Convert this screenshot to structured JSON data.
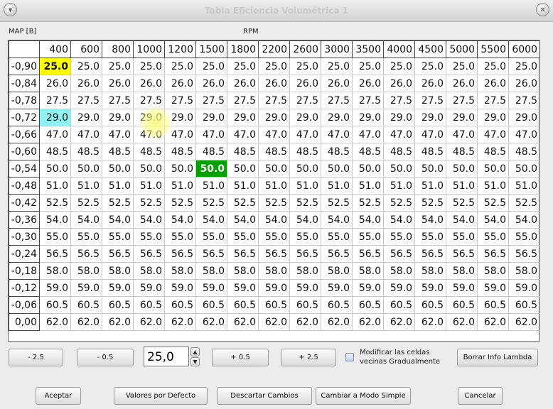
{
  "window": {
    "title": "Tabla Eficiencia Volumétrica 1",
    "menu_icon": "chevron-down-icon",
    "close_icon": "close-icon"
  },
  "axes": {
    "y_label": "MAP [B]",
    "x_label": "RPM"
  },
  "table": {
    "columns": [
      "400",
      "600",
      "800",
      "1000",
      "1200",
      "1500",
      "1800",
      "2200",
      "2600",
      "3000",
      "3500",
      "4000",
      "4500",
      "5000",
      "5500",
      "6000"
    ],
    "rows": [
      {
        "label": "-0,90",
        "value": "25.0"
      },
      {
        "label": "-0,84",
        "value": "26.0"
      },
      {
        "label": "-0,78",
        "value": "27.5"
      },
      {
        "label": "-0,72",
        "value": "29.0"
      },
      {
        "label": "-0,66",
        "value": "47.0"
      },
      {
        "label": "-0,60",
        "value": "48.5"
      },
      {
        "label": "-0,54",
        "value": "50.0"
      },
      {
        "label": "-0,48",
        "value": "51.0"
      },
      {
        "label": "-0,42",
        "value": "52.5"
      },
      {
        "label": "-0,36",
        "value": "54.0"
      },
      {
        "label": "-0,30",
        "value": "55.0"
      },
      {
        "label": "-0,24",
        "value": "56.5"
      },
      {
        "label": "-0,18",
        "value": "58.0"
      },
      {
        "label": "-0,12",
        "value": "59.0"
      },
      {
        "label": "-0,06",
        "value": "60.5"
      },
      {
        "label": "0,00",
        "value": "62.0"
      }
    ],
    "highlights": [
      {
        "row": 0,
        "col": 0,
        "color": "#ffff00"
      },
      {
        "row": 3,
        "col": 0,
        "color": "#8ff3f3"
      },
      {
        "row": 6,
        "col": 5,
        "color": "#00a000"
      }
    ]
  },
  "controls": {
    "minus_2_5": "- 2.5",
    "minus_0_5": "- 0.5",
    "value": "25,0",
    "plus_0_5": "+ 0.5",
    "plus_2_5": "+ 2.5",
    "neighbors_checkbox": "Modificar las celdas vecinas Gradualmente",
    "clear_lambda": "Borrar Info Lambda"
  },
  "footer": {
    "accept": "Aceptar",
    "defaults": "Valores por Defecto",
    "discard": "Descartar Cambios",
    "simple_mode": "Cambiar a Modo Simple",
    "cancel": "Cancelar"
  }
}
